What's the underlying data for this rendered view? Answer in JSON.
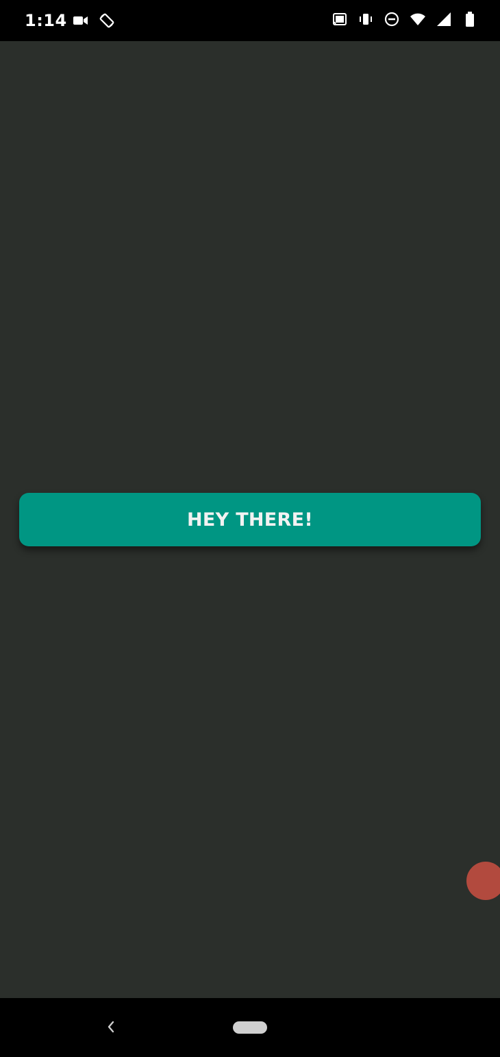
{
  "status_bar": {
    "time": "1:14",
    "left_icons": [
      "video-camera-icon",
      "rotate-screen-icon"
    ],
    "right_icons": [
      "cast-icon",
      "vibrate-icon",
      "do-not-disturb-icon",
      "wifi-icon",
      "signal-icon",
      "battery-icon"
    ]
  },
  "main": {
    "button_label": "HEY THERE!",
    "background_color": "#2b2f2b",
    "button_color": "#009683"
  },
  "floating_bubble": {
    "color": "#b24a3e"
  },
  "nav_bar": {
    "back_icon": "back-chevron-icon",
    "home_icon": "home-pill-icon"
  }
}
